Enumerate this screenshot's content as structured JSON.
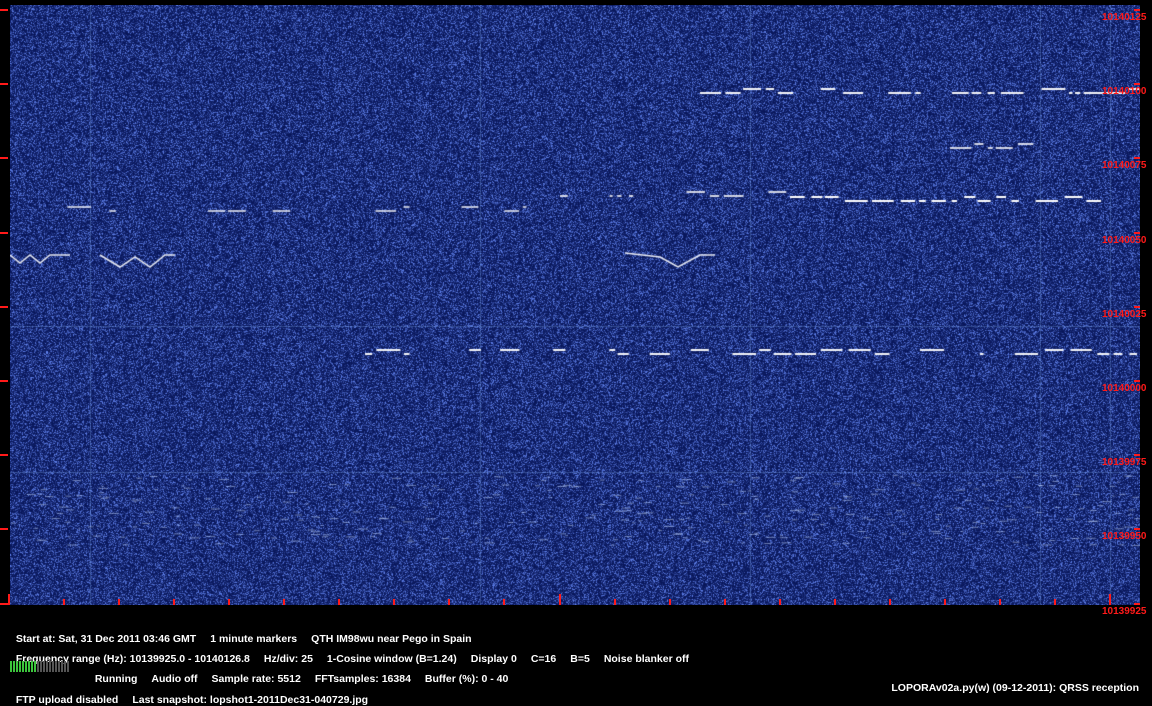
{
  "waterfall": {
    "freq_labels": [
      "10140125",
      "10140100",
      "10140075",
      "10140050",
      "10140025",
      "10140000",
      "10139975",
      "10139950",
      "10139925"
    ],
    "colors": {
      "background": "#0a1a5c",
      "marker": "#ff1a1a",
      "signal": "#ffffff"
    }
  },
  "status": {
    "line1": [
      "Start at: Sat, 31 Dec 2011 03:46 GMT",
      "1 minute markers",
      "QTH IM98wu near Pego in Spain"
    ],
    "line2": [
      "Frequency range (Hz): 10139925.0 - 10140126.8",
      "Hz/div: 25",
      "1-Cosine window (B=1.24)",
      "Display 0",
      "C=16",
      "B=5",
      "Noise blanker off"
    ],
    "line3": [
      "Running",
      "Audio off",
      "Sample rate: 5512",
      "FFTsamples: 16384",
      "Buffer (%): 0 - 40"
    ],
    "line4": [
      "FTP upload disabled",
      "Last snapshot: lopshot1-2011Dec31-040729.jpg"
    ],
    "version": "LOPORAv02a.py(w) (09-12-2011): QRSS reception",
    "audio_level_fraction": 0.45
  }
}
